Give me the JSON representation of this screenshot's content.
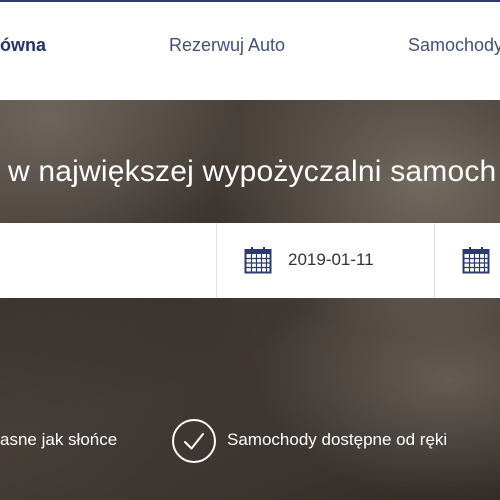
{
  "nav": {
    "home_label": "ówna",
    "reserve_label": "Rezerwuj Auto",
    "cars_label": "Samochody"
  },
  "hero": {
    "headline": "w największej wypożyczalni samoch"
  },
  "search": {
    "pickup_date": "2019-01-11"
  },
  "features": {
    "item1": "asne jak słońce",
    "item2": "Samochody dostępne od ręki"
  },
  "colors": {
    "accent": "#2b3b6e",
    "calendar_icon": "#2b3b6e"
  }
}
